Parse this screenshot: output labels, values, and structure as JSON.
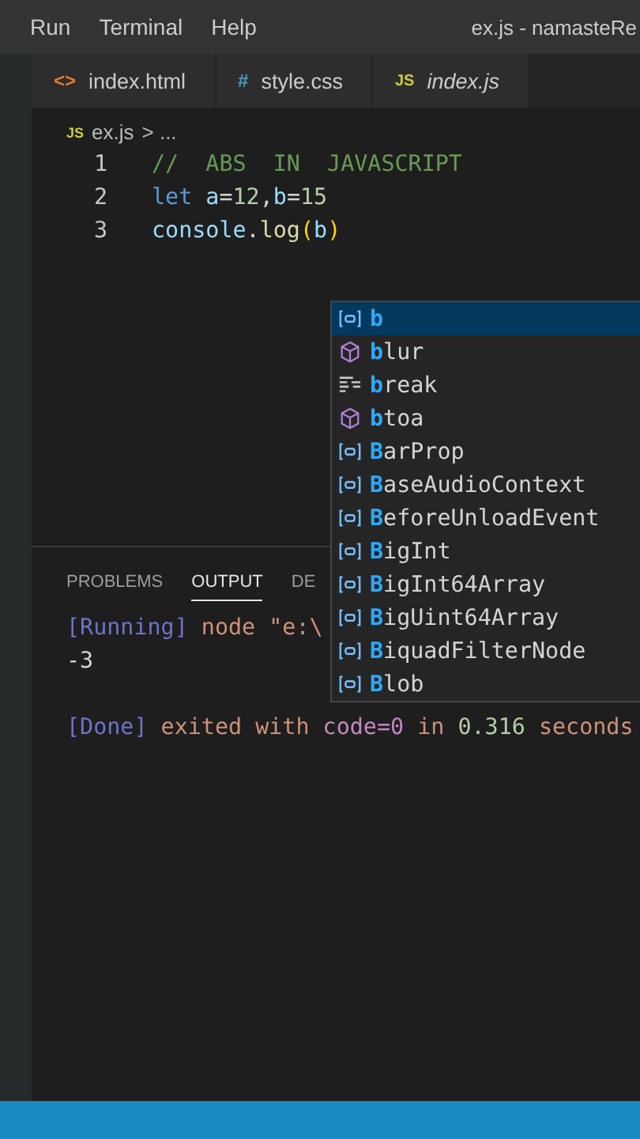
{
  "menu": [
    "Run",
    "Terminal",
    "Help"
  ],
  "window": {
    "title": "ex.js - namasteRe"
  },
  "tabs": [
    {
      "kind": "html",
      "icon_text": "<>",
      "label": "index.html",
      "italic": false
    },
    {
      "kind": "css",
      "icon_text": "#",
      "label": "style.css",
      "italic": false
    },
    {
      "kind": "js",
      "icon_text": "JS",
      "label": "index.js",
      "italic": true
    }
  ],
  "breadcrumb": {
    "icon_text": "JS",
    "file": "ex.js",
    "rest": "> ..."
  },
  "code_lines": [
    {
      "number": "1",
      "tokens": [
        {
          "kind": "comment",
          "text": "//  ABS  IN  JAVASCRIPT"
        }
      ]
    },
    {
      "number": "2",
      "tokens": [
        {
          "kind": "keyword",
          "text": "let "
        },
        {
          "kind": "variable",
          "text": "a"
        },
        {
          "kind": "plain",
          "text": "="
        },
        {
          "kind": "number",
          "text": "12"
        },
        {
          "kind": "plain",
          "text": ","
        },
        {
          "kind": "variable",
          "text": "b"
        },
        {
          "kind": "plain",
          "text": "="
        },
        {
          "kind": "number",
          "text": "15"
        }
      ]
    },
    {
      "number": "3",
      "tokens": [
        {
          "kind": "variable",
          "text": "console"
        },
        {
          "kind": "plain",
          "text": "."
        },
        {
          "kind": "function",
          "text": "log"
        },
        {
          "kind": "bracket",
          "text": "("
        },
        {
          "kind": "variable",
          "text": "b"
        },
        {
          "kind": "bracket",
          "text": ")"
        }
      ]
    }
  ],
  "suggestions": [
    {
      "kind": "variable",
      "match": "b",
      "selected": true
    },
    {
      "kind": "module",
      "match": "b",
      "rest": "lur",
      "selected": false
    },
    {
      "kind": "keyword",
      "match": "b",
      "rest": "reak",
      "selected": false
    },
    {
      "kind": "module",
      "match": "b",
      "rest": "toa",
      "selected": false
    },
    {
      "kind": "variable",
      "match": "B",
      "rest": "arProp",
      "selected": false
    },
    {
      "kind": "variable",
      "match": "B",
      "rest": "aseAudioContext",
      "selected": false
    },
    {
      "kind": "variable",
      "match": "B",
      "rest": "eforeUnloadEvent",
      "selected": false
    },
    {
      "kind": "variable",
      "match": "B",
      "rest": "igInt",
      "selected": false
    },
    {
      "kind": "variable",
      "match": "B",
      "rest": "igInt64Array",
      "selected": false
    },
    {
      "kind": "variable",
      "match": "B",
      "rest": "igUint64Array",
      "selected": false
    },
    {
      "kind": "variable",
      "match": "B",
      "rest": "iquadFilterNode",
      "selected": false
    },
    {
      "kind": "variable",
      "match": "B",
      "rest": "lob",
      "selected": false
    }
  ],
  "panel_tabs": [
    {
      "label": "PROBLEMS",
      "selected": false
    },
    {
      "label": "OUTPUT",
      "selected": true
    },
    {
      "label": "DE",
      "selected": false
    }
  ],
  "output_lines": [
    [
      {
        "kind": "bracket",
        "text": "[Running] "
      },
      {
        "kind": "string",
        "text": "node \"e:\\"
      }
    ],
    [
      {
        "kind": "text",
        "text": "-3"
      }
    ],
    [
      {
        "kind": "bracket",
        "text": "[Done] "
      },
      {
        "kind": "string",
        "text": "exited with "
      },
      {
        "kind": "keyword",
        "text": "code=0 "
      },
      {
        "kind": "string",
        "text": "in "
      },
      {
        "kind": "number",
        "text": "0.316 "
      },
      {
        "kind": "string",
        "text": "seconds"
      }
    ]
  ]
}
